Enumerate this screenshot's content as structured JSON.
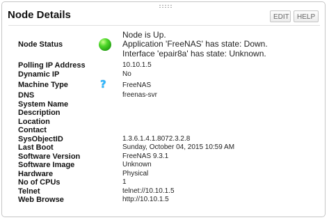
{
  "header": {
    "title": "Node Details",
    "edit_label": "EDIT",
    "help_label": "HELP"
  },
  "status": {
    "label": "Node Status",
    "icon": "green-status-icon",
    "lines": [
      "Node is Up.",
      "Application 'FreeNAS' has state: Down.",
      "Interface 'epair8a' has state: Unknown."
    ]
  },
  "rows": [
    {
      "label": "Polling IP Address",
      "value": "10.10.1.5"
    },
    {
      "label": "Dynamic IP",
      "value": "No"
    },
    {
      "label": "Machine Type",
      "value": "FreeNAS",
      "icon": "question-icon"
    },
    {
      "label": "DNS",
      "value": "freenas-svr"
    },
    {
      "label": "System Name",
      "value": ""
    },
    {
      "label": "Description",
      "value": ""
    },
    {
      "label": "Location",
      "value": ""
    },
    {
      "label": "Contact",
      "value": ""
    },
    {
      "label": "SysObjectID",
      "value": "1.3.6.1.4.1.8072.3.2.8"
    },
    {
      "label": "Last Boot",
      "value": "Sunday, October 04, 2015 10:59 AM"
    },
    {
      "label": "Software Version",
      "value": "FreeNAS 9.3.1"
    },
    {
      "label": "Software Image",
      "value": "Unknown"
    },
    {
      "label": "Hardware",
      "value": "Physical"
    },
    {
      "label": "No of CPUs",
      "value": "1"
    },
    {
      "label": "Telnet",
      "value": "telnet://10.10.1.5"
    },
    {
      "label": "Web Browse",
      "value": "http://10.10.1.5"
    }
  ]
}
